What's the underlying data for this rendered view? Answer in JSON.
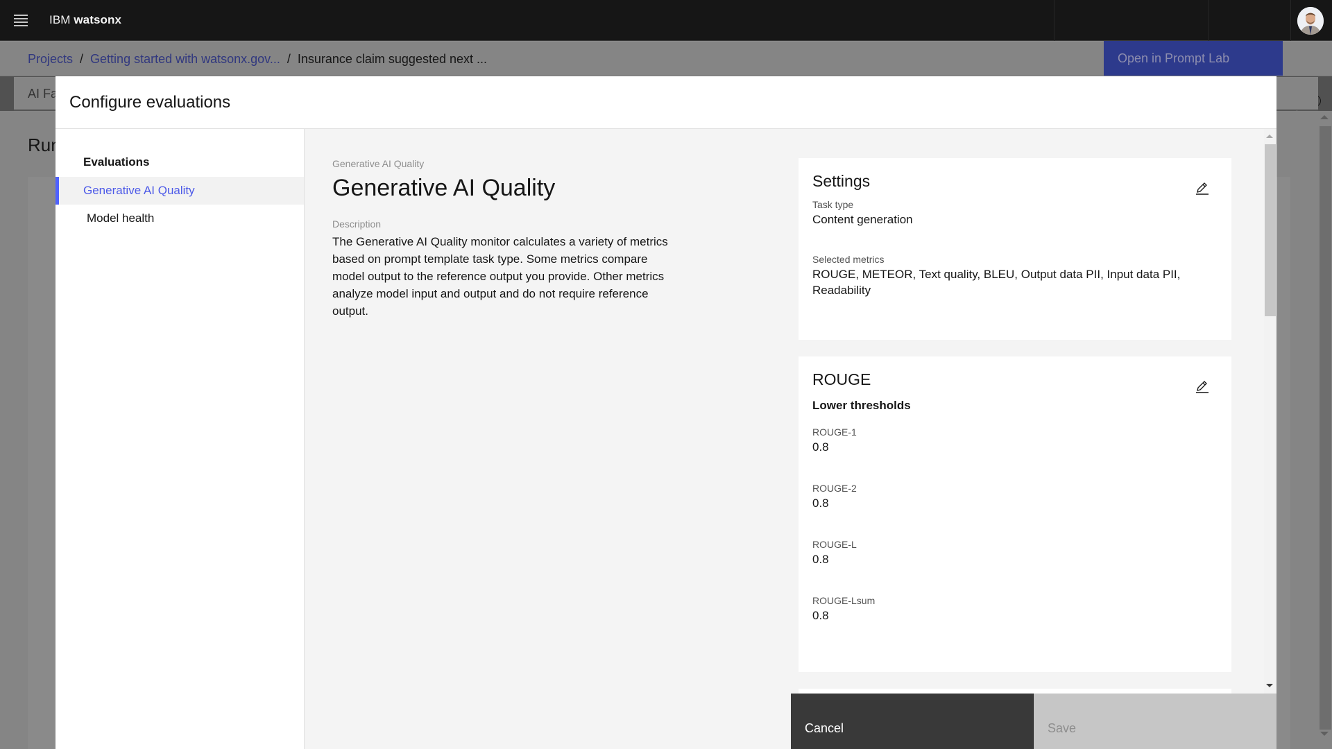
{
  "shell": {
    "brand_prefix": "IBM",
    "brand_name": "watsonx",
    "menu_icon": "hamburger-menu-icon",
    "avatar_icon": "user-avatar"
  },
  "breadcrumb": {
    "items": [
      {
        "label": "Projects"
      },
      {
        "label": "Getting started with watsonx.gov..."
      }
    ],
    "separator": "/",
    "current": "Insurance claim suggested next ..."
  },
  "actions": {
    "open_prompt_lab": "Open in Prompt Lab",
    "info_icon": "i"
  },
  "background_page": {
    "tab_label": "AI Fa",
    "title": "Run"
  },
  "modal": {
    "title": "Configure evaluations",
    "nav": {
      "heading": "Evaluations",
      "items": [
        {
          "label": "Generative AI Quality",
          "active": true
        },
        {
          "label": "Model health",
          "active": false
        }
      ]
    },
    "content": {
      "eyebrow": "Generative AI Quality",
      "heading": "Generative AI Quality",
      "description_label": "Description",
      "description": "The Generative AI Quality monitor calculates a variety of metrics based on prompt template task type. Some metrics compare model output to the reference output you provide. Other metrics analyze model input and output and do not require reference output."
    },
    "settings_card": {
      "title": "Settings",
      "task_type_label": "Task type",
      "task_type_value": "Content generation",
      "selected_metrics_label": "Selected metrics",
      "selected_metrics_value": "ROUGE, METEOR, Text quality, BLEU, Output data PII, Input data PII, Readability"
    },
    "rouge_card": {
      "title": "ROUGE",
      "subheading": "Lower thresholds",
      "thresholds": [
        {
          "label": "ROUGE-1",
          "value": "0.8"
        },
        {
          "label": "ROUGE-2",
          "value": "0.8"
        },
        {
          "label": "ROUGE-L",
          "value": "0.8"
        },
        {
          "label": "ROUGE-Lsum",
          "value": "0.8"
        }
      ]
    },
    "footer": {
      "cancel": "Cancel",
      "save": "Save"
    }
  },
  "colors": {
    "accent": "#4f62ff",
    "link": "#4d5ae8",
    "header_bg": "#161616",
    "cancel_bg": "#393939",
    "save_disabled_bg": "#c6c6c6"
  }
}
